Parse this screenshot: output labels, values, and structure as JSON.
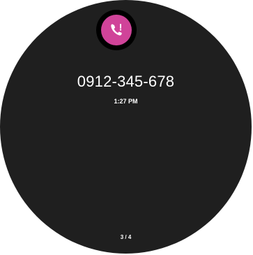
{
  "notification": {
    "icon": "missed-call-icon",
    "accent_color": "#d04399",
    "caller_number": "0912-345-678",
    "time": "1:27 PM"
  },
  "pager": {
    "label": "3 / 4"
  }
}
